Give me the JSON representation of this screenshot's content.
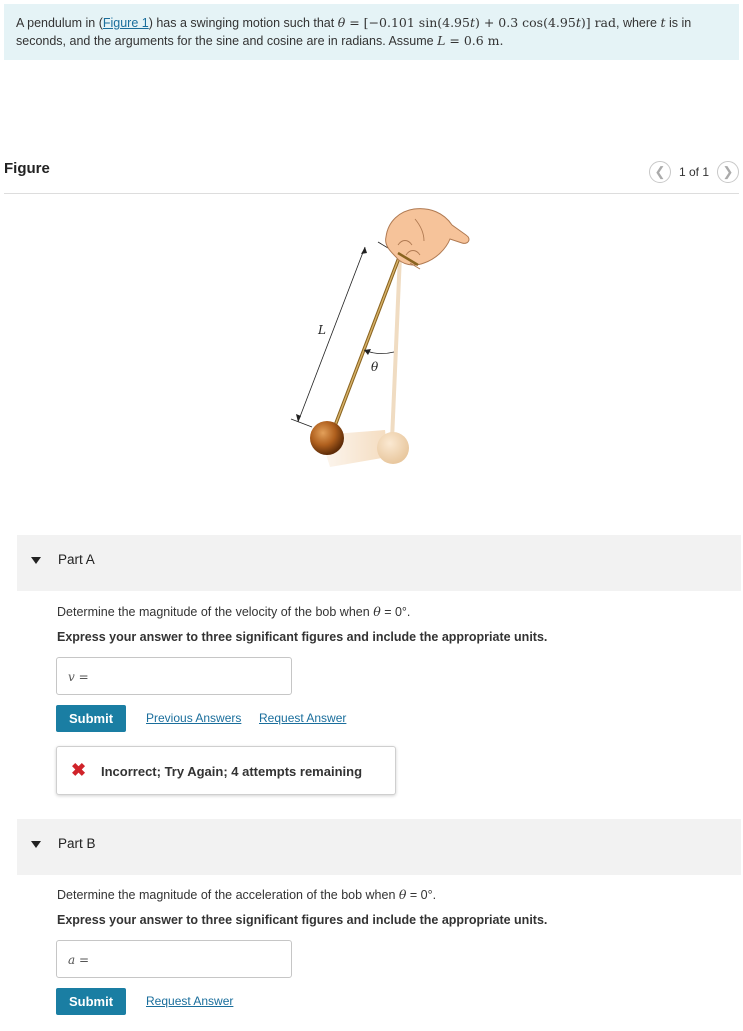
{
  "problem": {
    "intro": "A pendulum in (",
    "figure_link": "Figure 1",
    "after_link": ") has a swinging motion such that",
    "theta": "θ",
    "equation": " = [−0.101 sin(4.95",
    "t1": "t",
    "eq_mid": ") + 0.3 cos(4.95",
    "t2": "t",
    "eq_end": ")] rad",
    "after_eq": ", where",
    "t3": "t",
    "line1_end": "is in",
    "line2": "seconds, and the arguments for the sine and cosine are in radians. Assume",
    "L": "L",
    "L_value": " = 0.6 m."
  },
  "figure": {
    "title": "Figure",
    "page_counter": "1 of 1",
    "prev_icon": "chevron-left-icon",
    "next_icon": "chevron-right-icon",
    "labels": {
      "length": "L",
      "angle": "θ"
    }
  },
  "partA": {
    "title": "Part A",
    "question_prefix": "Determine the magnitude of the velocity of the bob when",
    "question_theta": "θ",
    "question_suffix": " = 0°.",
    "instruction": "Express your answer to three significant figures and include the appropriate units.",
    "var": "v",
    "eq": " =",
    "input_value": "",
    "submit": "Submit",
    "previous_answers": "Previous Answers",
    "request_answer": "Request Answer",
    "feedback_icon": "✖",
    "feedback": "Incorrect; Try Again; 4 attempts remaining"
  },
  "partB": {
    "title": "Part B",
    "question_prefix": "Determine the magnitude of the acceleration of the bob when",
    "question_theta": "θ",
    "question_suffix": " = 0°.",
    "instruction": "Express your answer to three significant figures and include the appropriate units.",
    "var": "a",
    "eq": " =",
    "input_value": "",
    "submit": "Submit",
    "request_answer": "Request Answer"
  },
  "colors": {
    "problem_bg": "#e5f3f6",
    "accent": "#1a7ea3",
    "link": "#1a6e9c",
    "error": "#d0232a",
    "part_bg": "#f2f2f2"
  }
}
